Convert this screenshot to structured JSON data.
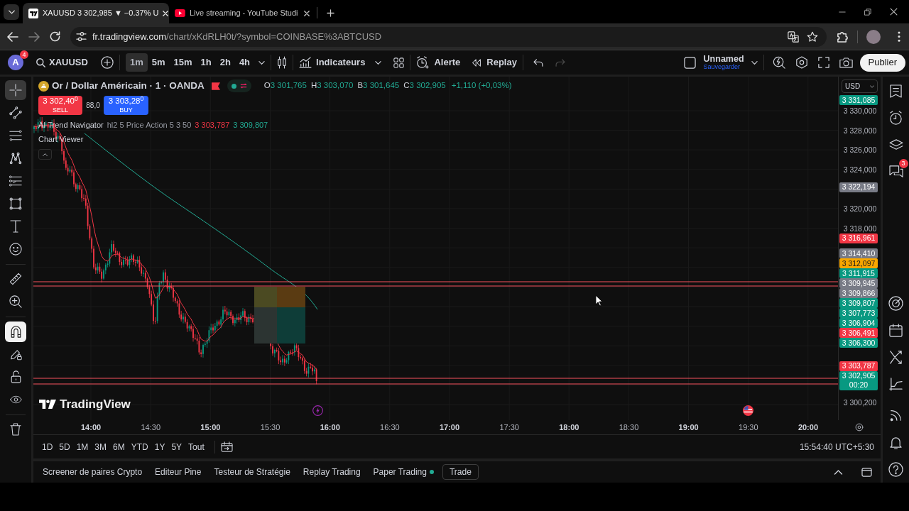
{
  "browser": {
    "tabs": [
      {
        "title": "XAUUSD 3 302,985 ▼ −0.37% U",
        "selected": true,
        "kind": "chart"
      },
      {
        "title": "Live streaming - YouTube Studi",
        "selected": false,
        "kind": "video"
      }
    ],
    "address": {
      "host": "fr.tradingview.com",
      "path": "/chart/xKdRLH0t/?symbol=COINBASE%3ABTCUSD"
    }
  },
  "toolbar": {
    "avatar": {
      "letter": "A",
      "badge": "4"
    },
    "symbol": "XAUUSD",
    "intervals": [
      {
        "label": "1m",
        "selected": true
      },
      {
        "label": "5m",
        "selected": false
      },
      {
        "label": "15m",
        "selected": false
      },
      {
        "label": "1h",
        "selected": false
      },
      {
        "label": "2h",
        "selected": false
      },
      {
        "label": "4h",
        "selected": false
      }
    ],
    "indicators": "Indicateurs",
    "alert": "Alerte",
    "replay": "Replay",
    "layout": {
      "name": "Unnamed",
      "save": "Sauvegarder"
    },
    "publish": "Publier"
  },
  "left_toolbar": {
    "tools": [
      {
        "kind": "crosshair",
        "selected": true
      },
      {
        "kind": "trend_line",
        "selected": false
      },
      {
        "kind": "fib",
        "selected": false
      },
      {
        "kind": "pattern",
        "selected": false
      },
      {
        "kind": "forecast",
        "selected": false
      },
      {
        "kind": "shape",
        "selected": false
      },
      {
        "kind": "text",
        "selected": false
      },
      {
        "kind": "emoji",
        "selected": false
      },
      {
        "kind": "measure",
        "selected": false
      },
      {
        "kind": "zoom",
        "selected": false
      }
    ],
    "toggles": [
      {
        "kind": "magnet",
        "on": true
      },
      {
        "kind": "draw_lock",
        "on": false
      },
      {
        "kind": "lock",
        "on": false
      },
      {
        "kind": "hide",
        "on": false
      }
    ]
  },
  "legend": {
    "title": "Or / Dollar Américain · 1 · OANDA",
    "ohlc": [
      {
        "label": "O",
        "value": "3 301,765"
      },
      {
        "label": "H",
        "value": "3 303,070"
      },
      {
        "label": "B",
        "value": "3 301,645"
      },
      {
        "label": "C",
        "value": "3 302,905"
      }
    ],
    "change": "+1,110 (+0,03%)",
    "sell": {
      "price": "3 302,40$^{0}$",
      "label": "SELL"
    },
    "spread": "88,0",
    "buy": {
      "price": "3 303,28$^{0}$",
      "label": "BUY"
    },
    "indicators": [
      {
        "name": "AI Trend Navigator",
        "params": "hl2 5 Price Action 5 3 50",
        "values": [
          {
            "text": "3 303,787",
            "color": "#f23645"
          },
          {
            "text": "3 309,807",
            "color": "#22ab94"
          }
        ]
      },
      {
        "name": "Chart Viewer"
      }
    ]
  },
  "chart_logo": "TradingView",
  "price_axis": {
    "currency": "USD",
    "labels": [
      {
        "text": "3 331,085",
        "kind": "badge",
        "color": "#089981"
      },
      {
        "text": "3 330,000",
        "kind": "tick"
      },
      {
        "text": "3 328,000",
        "kind": "tick"
      },
      {
        "text": "3 326,000",
        "kind": "tick"
      },
      {
        "text": "3 324,000",
        "kind": "tick"
      },
      {
        "text": "3 322,194",
        "kind": "badge",
        "color": "#787b86"
      },
      {
        "text": "3 320,000",
        "kind": "tick"
      },
      {
        "text": "3 318,000",
        "kind": "tick"
      },
      {
        "text": "3 316,961",
        "kind": "badge",
        "color": "#f23645"
      },
      {
        "text": "3 314,410",
        "kind": "badge",
        "color": "#787b86"
      },
      {
        "text": "3 312,097",
        "kind": "badge",
        "color": "#f7a600"
      },
      {
        "text": "3 311,915",
        "kind": "badge",
        "color": "#089981"
      },
      {
        "text": "3 309,945",
        "kind": "badge",
        "color": "#787b86"
      },
      {
        "text": "3 309,866",
        "kind": "badge",
        "color": "#787b86"
      },
      {
        "text": "3 309,807",
        "kind": "badge",
        "color": "#089981"
      },
      {
        "text": "3 307,773",
        "kind": "badge",
        "color": "#089981"
      },
      {
        "text": "3 306,904",
        "kind": "badge",
        "color": "#089981"
      },
      {
        "text": "3 306,491",
        "kind": "badge",
        "color": "#f23645"
      },
      {
        "text": "3 306,300",
        "kind": "badge",
        "color": "#089981"
      },
      {
        "text": "3 303,787",
        "kind": "badge",
        "color": "#f23645"
      },
      {
        "text": "3 302,905",
        "kind": "badge",
        "color": "#089981",
        "countdown": "00:20"
      },
      {
        "text": "3 300,200",
        "kind": "tick"
      }
    ]
  },
  "time_axis": [
    {
      "text": "14:00",
      "major": true
    },
    {
      "text": "14:30",
      "major": false
    },
    {
      "text": "15:00",
      "major": true
    },
    {
      "text": "15:30",
      "major": false
    },
    {
      "text": "16:00",
      "major": true
    },
    {
      "text": "16:30",
      "major": false
    },
    {
      "text": "17:00",
      "major": true
    },
    {
      "text": "17:30",
      "major": false
    },
    {
      "text": "18:00",
      "major": true
    },
    {
      "text": "18:30",
      "major": false
    },
    {
      "text": "19:00",
      "major": true
    },
    {
      "text": "19:30",
      "major": false
    },
    {
      "text": "20:00",
      "major": true
    }
  ],
  "ranges": [
    "1D",
    "5D",
    "1M",
    "3M",
    "6M",
    "YTD",
    "1Y",
    "5Y",
    "Tout"
  ],
  "clock": "15:54:40 UTC+5:30",
  "bottom_tabs": [
    {
      "label": "Screener de paires Crypto",
      "selected": false,
      "status_dot": false
    },
    {
      "label": "Editeur Pine",
      "selected": false,
      "status_dot": false
    },
    {
      "label": "Testeur de Stratégie",
      "selected": false,
      "status_dot": false
    },
    {
      "label": "Replay Trading",
      "selected": false,
      "status_dot": false
    },
    {
      "label": "Paper Trading",
      "selected": false,
      "status_dot": true
    },
    {
      "label": "Trade",
      "selected": true,
      "status_dot": false
    }
  ],
  "right_sidebar": {
    "chat_badge": "3"
  }
}
